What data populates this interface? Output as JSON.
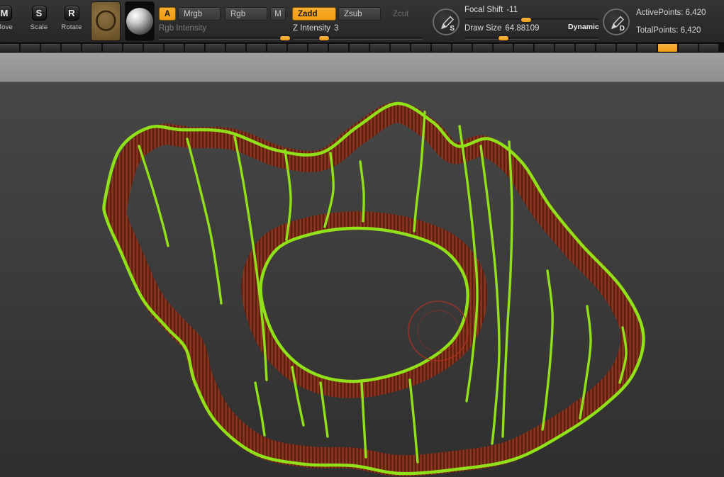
{
  "toolbar": {
    "transform_tools": [
      {
        "key": "M",
        "label": "Move"
      },
      {
        "key": "S",
        "label": "Scale"
      },
      {
        "key": "R",
        "label": "Rotate"
      }
    ],
    "mode_buttons": [
      {
        "label": "A"
      },
      {
        "label": "Mrgb"
      },
      {
        "label": "Rgb"
      },
      {
        "label": "M"
      },
      {
        "label": "Zadd"
      },
      {
        "label": "Zsub"
      },
      {
        "label": "Zcut"
      }
    ],
    "sliders": {
      "rgb_intensity": {
        "label": "Rgb Intensity",
        "value": ""
      },
      "z_intensity": {
        "label": "Z Intensity",
        "value": "3"
      },
      "focal_shift": {
        "label": "Focal Shift",
        "value": "-11"
      },
      "draw_size": {
        "label": "Draw Size",
        "value": "64.88109"
      }
    },
    "dynamic_label": "Dynamic",
    "stroke_button_label": "S",
    "draw_button_label": "D",
    "stats": {
      "active_points": "ActivePoints: 6,420",
      "total_points": "TotalPoints: 6,420"
    }
  },
  "colors": {
    "accent_orange": "#f29c13",
    "stroke_green": "#90e01a",
    "clay_red": "#7b2d1a",
    "cursor_red": "#b43122"
  }
}
